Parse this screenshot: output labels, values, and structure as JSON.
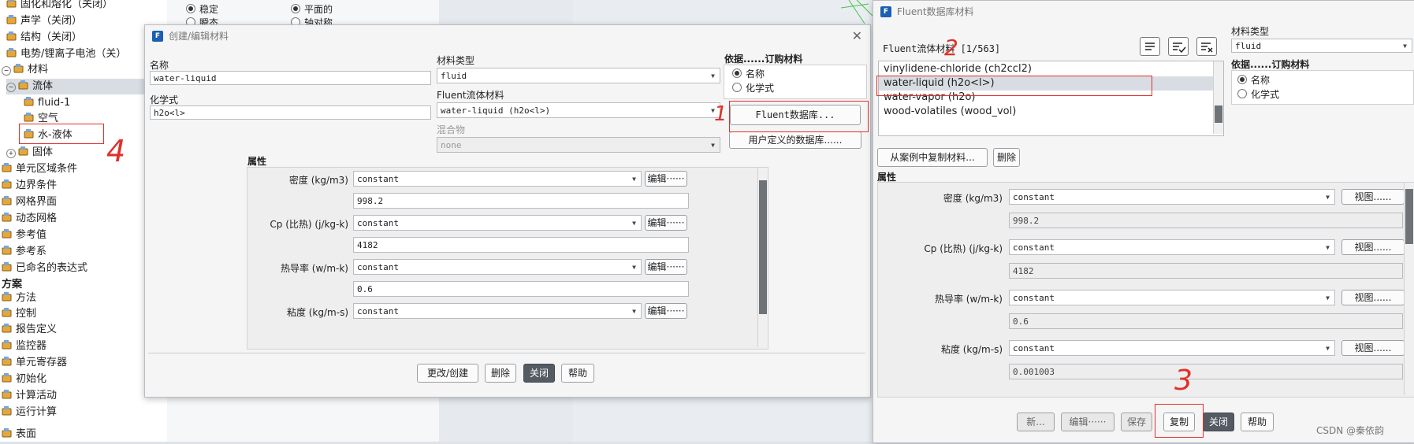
{
  "tree": {
    "items": [
      {
        "label": "固化和熔化（关闭）",
        "icon": "solidification-icon",
        "indent": 1
      },
      {
        "label": "声学（关闭）",
        "icon": "acoustics-icon",
        "indent": 1
      },
      {
        "label": "结构（关闭）",
        "icon": "structure-icon",
        "indent": 1
      },
      {
        "label": "电势/锂离子电池（关）",
        "icon": "battery-icon",
        "indent": 1
      },
      {
        "label": "材料",
        "icon": "materials-icon",
        "indent": 0
      },
      {
        "label": "流体",
        "icon": "fluid-icon",
        "indent": 1
      },
      {
        "label": "fluid-1",
        "icon": "fluid-icon",
        "indent": 2
      },
      {
        "label": "空气",
        "icon": "fluid-icon",
        "indent": 2
      },
      {
        "label": "水-液体",
        "icon": "fluid-icon",
        "indent": 2
      },
      {
        "label": "固体",
        "icon": "solid-icon",
        "indent": 1
      },
      {
        "label": "单元区域条件",
        "icon": "cell-zone-icon",
        "indent": 0
      },
      {
        "label": "边界条件",
        "icon": "boundary-icon",
        "indent": 0
      },
      {
        "label": "网格界面",
        "icon": "mesh-interface-icon",
        "indent": 0
      },
      {
        "label": "动态网格",
        "icon": "dynamic-mesh-icon",
        "indent": 0
      },
      {
        "label": "参考值",
        "icon": "reference-icon",
        "indent": 0
      },
      {
        "label": "参考系",
        "icon": "reference-frame-icon",
        "indent": 0
      },
      {
        "label": "已命名的表达式",
        "icon": "expression-icon",
        "indent": 0
      },
      {
        "label": "方案",
        "icon": "",
        "indent": 0
      },
      {
        "label": "方法",
        "icon": "methods-icon",
        "indent": 0
      },
      {
        "label": "控制",
        "icon": "controls-icon",
        "indent": 0
      },
      {
        "label": "报告定义",
        "icon": "report-icon",
        "indent": 0
      },
      {
        "label": "监控器",
        "icon": "monitor-icon",
        "indent": 0
      },
      {
        "label": "单元寄存器",
        "icon": "register-icon",
        "indent": 0
      },
      {
        "label": "初始化",
        "icon": "init-icon",
        "indent": 0
      },
      {
        "label": "计算活动",
        "icon": "activity-icon",
        "indent": 0
      },
      {
        "label": "运行计算",
        "icon": "run-icon",
        "indent": 0
      },
      {
        "label": "表面",
        "icon": "surface-icon",
        "indent": 0
      }
    ]
  },
  "midpanel": {
    "radio1": "稳定",
    "radio2": "瞬态",
    "radio3": "平面的",
    "radio4": "轴对称"
  },
  "left_dialog": {
    "title": "创建/编辑材料",
    "name_label": "名称",
    "name_value": "water-liquid",
    "material_type_label": "材料类型",
    "material_type_value": "fluid",
    "formula_label": "化学式",
    "formula_value": "h2o<l>",
    "fluent_fluid_label": "Fluent流体材料",
    "fluent_fluid_value": "water-liquid (h2o<l>)",
    "mixture_label": "混合物",
    "mixture_value": "none",
    "order_label": "依据......订购材料",
    "order_by_name": "名称",
    "order_by_formula": "化学式",
    "fluent_db_button": "Fluent数据库...",
    "user_db_button": "用户定义的数据库......",
    "properties_label": "属性",
    "props": [
      {
        "label": "密度 (kg/m3)",
        "method": "constant",
        "value": "998.2",
        "edit": "编辑······"
      },
      {
        "label": "Cp (比热) (j/kg-k)",
        "method": "constant",
        "value": "4182",
        "edit": "编辑······"
      },
      {
        "label": "热导率 (w/m-k)",
        "method": "constant",
        "value": "0.6",
        "edit": "编辑······"
      },
      {
        "label": "粘度 (kg/m-s)",
        "method": "constant",
        "value": "",
        "edit": "编辑······"
      }
    ],
    "buttons": {
      "change": "更改/创建",
      "delete": "删除",
      "close": "关闭",
      "help": "帮助"
    }
  },
  "right_dialog": {
    "title": "Fluent数据库材料",
    "list_label": "Fluent流体材料 [1/563]",
    "material_type_label": "材料类型",
    "material_type_value": "fluid",
    "order_label": "依据......订购材料",
    "order_by_name": "名称",
    "order_by_formula": "化学式",
    "list_items": [
      "vinylidene-chloride (ch2ccl2)",
      "water-liquid (h2o<l>)",
      "water-vapor (h2o)",
      "wood-volatiles (wood_vol)"
    ],
    "copy_from_case_button": "从案例中复制材料...",
    "delete_button": "删除",
    "properties_label": "属性",
    "props": [
      {
        "label": "密度 (kg/m3)",
        "method": "constant",
        "value": "998.2",
        "view": "视图......"
      },
      {
        "label": "Cp (比热) (j/kg-k)",
        "method": "constant",
        "value": "4182",
        "view": "视图......"
      },
      {
        "label": "热导率 (w/m-k)",
        "method": "constant",
        "value": "0.6",
        "view": "视图......"
      },
      {
        "label": "粘度 (kg/m-s)",
        "method": "constant",
        "value": "0.001003",
        "view": "视图......"
      }
    ],
    "buttons": {
      "new": "新...",
      "edit": "编辑······",
      "save": "保存",
      "copy": "复制",
      "close": "关闭",
      "help": "帮助"
    }
  },
  "annotations": {
    "n1": "1",
    "n2": "2",
    "n3": "3",
    "n4": "4"
  },
  "watermark": "CSDN @秦依韵",
  "colors": {
    "highlight": "#e0302a",
    "dark_button": "#555b63",
    "selected_row": "#d8dde3"
  }
}
